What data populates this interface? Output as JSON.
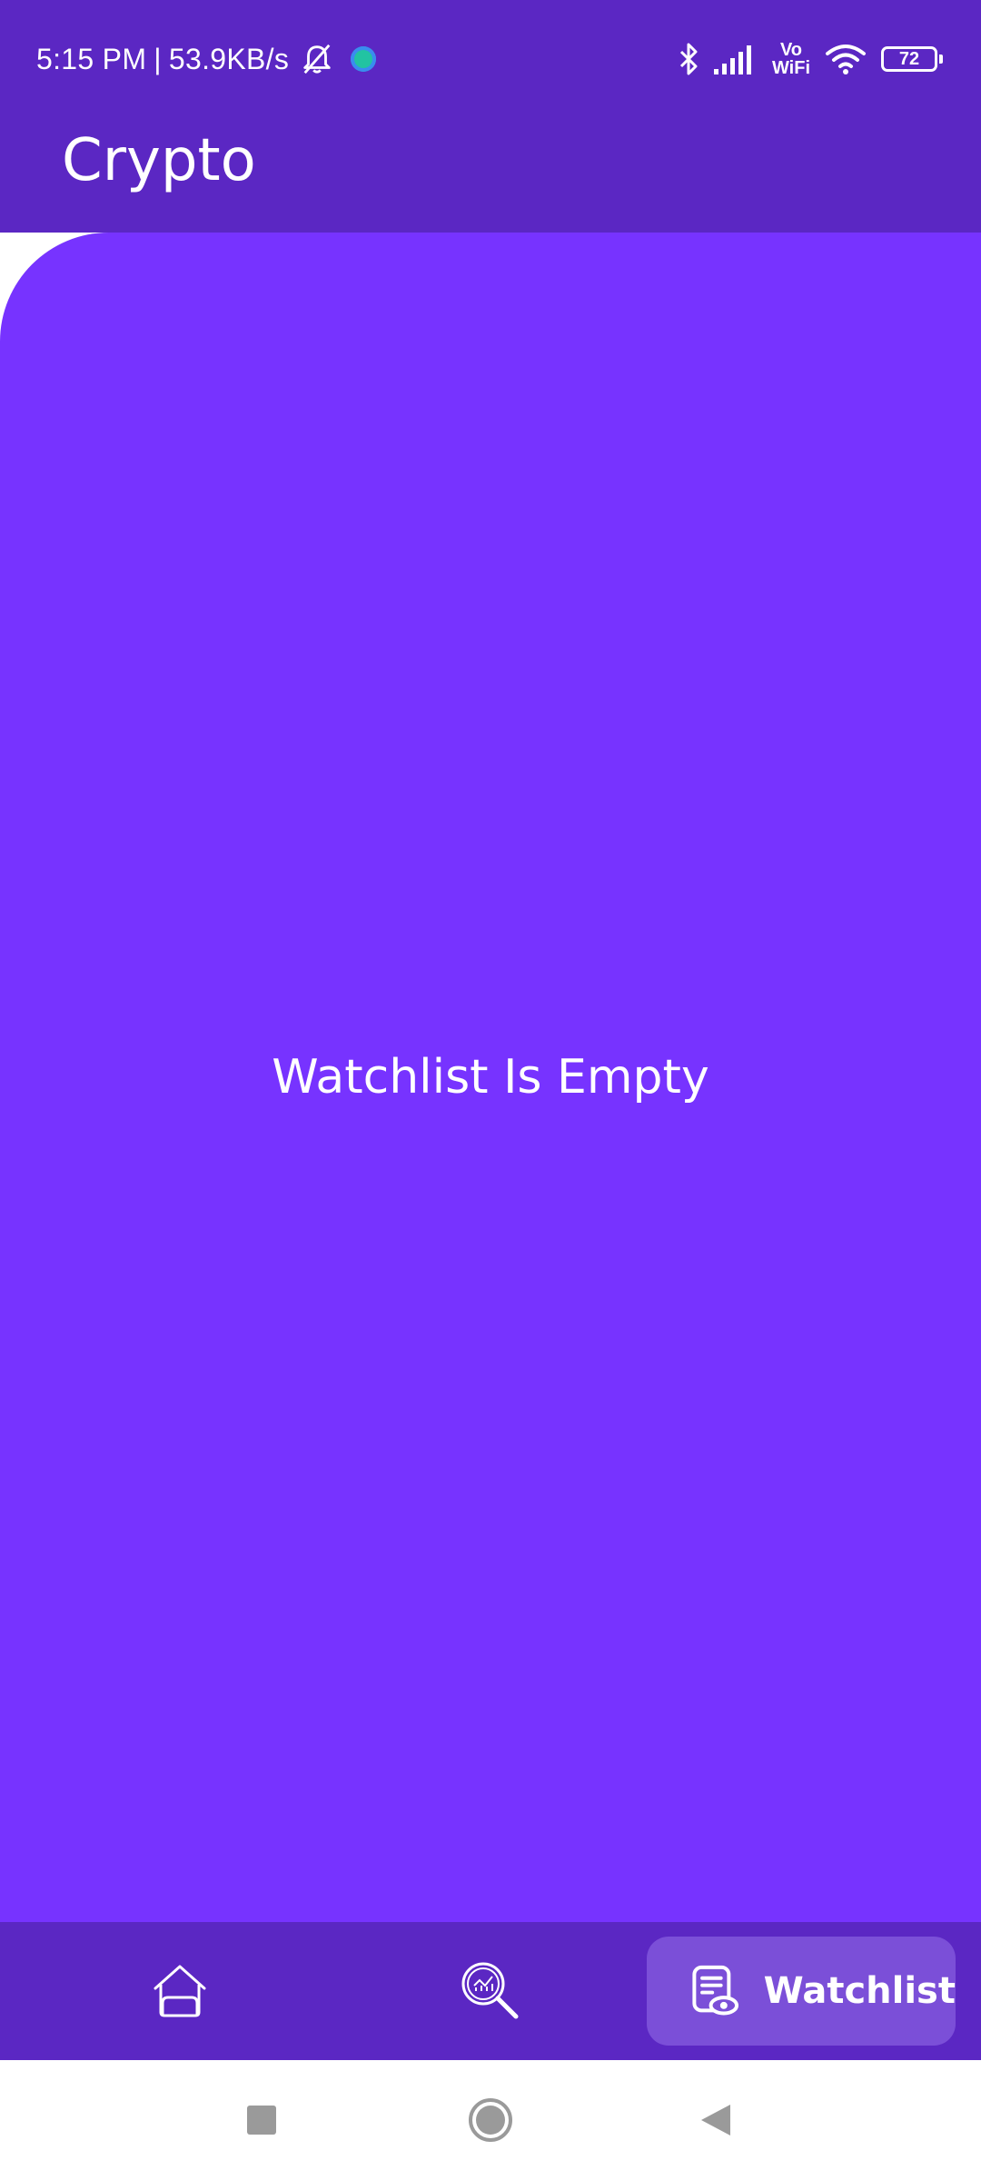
{
  "status_bar": {
    "time": "5:15 PM",
    "separator": "|",
    "speed": "53.9KB/s",
    "bell_icon": "bell-muted-icon",
    "vowifi_top": "Vo",
    "vowifi_bottom": "WiFi",
    "battery": "72"
  },
  "app": {
    "title": "Crypto"
  },
  "main": {
    "empty_message": "Watchlist Is Empty"
  },
  "bottom_nav": {
    "items": [
      {
        "icon": "home-icon",
        "label": ""
      },
      {
        "icon": "search-chart-icon",
        "label": ""
      },
      {
        "icon": "watchlist-icon",
        "label": "Watchlist"
      }
    ]
  },
  "system_nav": {
    "recent_icon": "square-icon",
    "home_icon": "circle-icon",
    "back_icon": "triangle-back-icon"
  },
  "colors": {
    "header_bg": "#5b27c3",
    "content_bg": "#7733ff",
    "active_nav_bg": "#7b4fd8"
  }
}
